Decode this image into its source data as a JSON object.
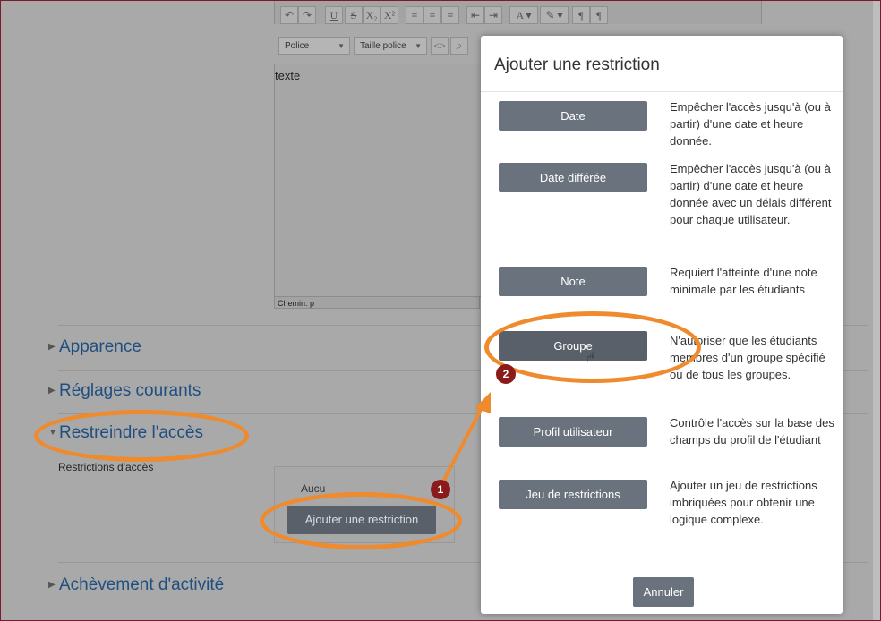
{
  "editor": {
    "font_select": "Police",
    "size_select": "Taille police",
    "content": "texte",
    "path": "Chemin: p",
    "toolbar_icons": [
      "undo-icon",
      "redo-icon",
      "underline-icon",
      "strikethrough-icon",
      "subscript-icon",
      "superscript-icon",
      "align-left-icon",
      "align-center-icon",
      "align-right-icon",
      "outdent-icon",
      "indent-icon",
      "font-color-icon",
      "highlight-icon",
      "ltr-icon",
      "rtl-icon"
    ]
  },
  "sections": {
    "apparence": "Apparence",
    "reglages": "Réglages courants",
    "restreindre": "Restreindre l'accès",
    "achevement": "Achèvement d'activité"
  },
  "restrictions": {
    "label": "Restrictions d'accès",
    "none_text": "Aucu",
    "add_button": "Ajouter une restriction"
  },
  "modal": {
    "title": "Ajouter une restriction",
    "options": [
      {
        "label": "Date",
        "desc": "Empêcher l'accès jusqu'à (ou à partir) d'une date et heure donnée."
      },
      {
        "label": "Date différée",
        "desc": "Empêcher l'accès jusqu'à (ou à partir) d'une date et heure donnée avec un délais différent pour chaque utilisateur."
      },
      {
        "label": "Note",
        "desc": "Requiert l'atteinte d'une note minimale par les étudiants"
      },
      {
        "label": "Groupe",
        "desc": "N'autoriser que les étudiants membres d'un groupe spécifié ou de tous les groupes."
      },
      {
        "label": "Profil utilisateur",
        "desc": "Contrôle l'accès sur la base des champs du profil de l'étudiant"
      },
      {
        "label": "Jeu de restrictions",
        "desc": "Ajouter un jeu de restrictions imbriquées pour obtenir une logique complexe."
      }
    ],
    "cancel": "Annuler"
  },
  "annotations": {
    "badge1": "1",
    "badge2": "2",
    "color": "#ef8a2d",
    "badge_color": "#8b1a1a"
  }
}
